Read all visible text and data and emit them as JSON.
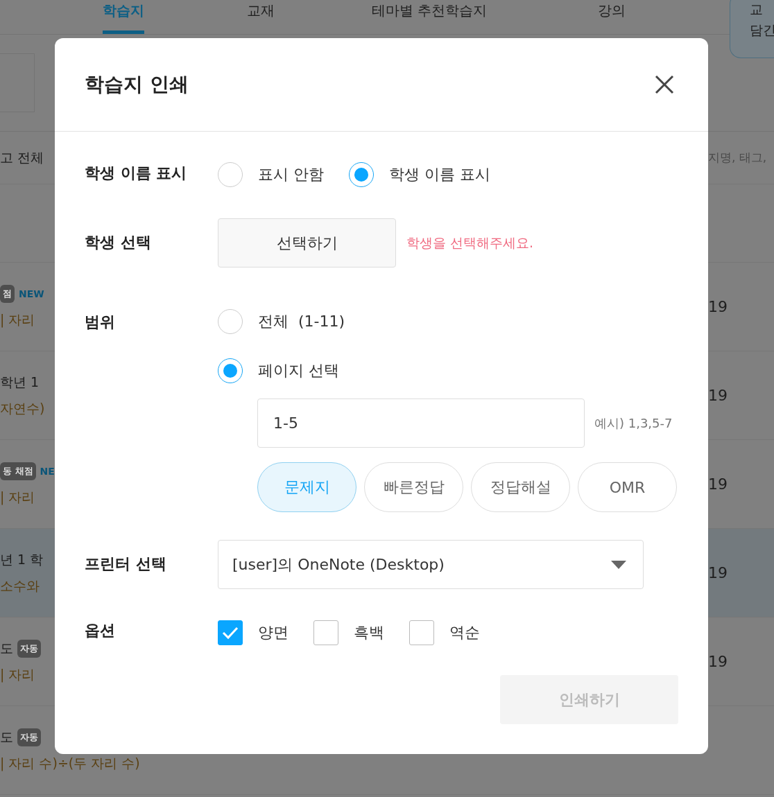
{
  "background": {
    "nav_tabs": [
      {
        "label": "학습지",
        "selected": true
      },
      {
        "label": "교재",
        "selected": false
      },
      {
        "label": "테마별 추천학습지",
        "selected": false
      },
      {
        "label": "강의",
        "selected": false
      }
    ],
    "side_button": {
      "line_1": "교",
      "line_2": "담긴"
    },
    "search_row": {
      "left": "고 전체",
      "right": "지명, 태그,"
    },
    "rows": [
      {
        "badge": "점",
        "tag": "NEW",
        "subtitle": "| 자리",
        "date": "19",
        "highlighted": false
      },
      {
        "title": "학년 1",
        "subtitle": "자연수)",
        "date": "19",
        "highlighted": false
      },
      {
        "badge": "동 채점",
        "tag": "NE",
        "subtitle": "| 자리",
        "date": "19",
        "highlighted": false
      },
      {
        "title": "년 1 학",
        "subtitle": "소수와",
        "date": "19",
        "highlighted": true
      },
      {
        "title": "도",
        "badge": "자동",
        "subtitle": "| 자리",
        "date": "19",
        "highlighted": false
      },
      {
        "title": "도",
        "badge": "자동",
        "subtitle": "| 자리 수)÷(두 자리 수)",
        "highlighted": false
      }
    ]
  },
  "dialog": {
    "title": "학습지 인쇄",
    "name_display": {
      "label": "학생 이름 표시",
      "options": [
        {
          "label": "표시 안함",
          "selected": false
        },
        {
          "label": "학생 이름 표시",
          "selected": true
        }
      ]
    },
    "student": {
      "label": "학생 선택",
      "button": "선택하기",
      "error": "학생을 선택해주세요."
    },
    "range": {
      "label": "범위",
      "options": [
        {
          "label": "전체  (1-11)",
          "selected": false
        },
        {
          "label": "페이지 선택",
          "selected": true
        }
      ],
      "pages_value": "1-5",
      "pages_hint": "예시) 1,3,5-7",
      "doc_types": [
        {
          "label": "문제지",
          "selected": true
        },
        {
          "label": "빠른정답",
          "selected": false
        },
        {
          "label": "정답해설",
          "selected": false
        },
        {
          "label": "OMR",
          "selected": false
        }
      ]
    },
    "printer": {
      "label": "프린터 선택",
      "value": "[user]의 OneNote (Desktop)"
    },
    "options": {
      "label": "옵션",
      "items": [
        {
          "label": "양면",
          "checked": true
        },
        {
          "label": "흑백",
          "checked": false
        },
        {
          "label": "역순",
          "checked": false
        }
      ]
    },
    "print_button": {
      "label": "인쇄하기",
      "disabled": true
    }
  }
}
